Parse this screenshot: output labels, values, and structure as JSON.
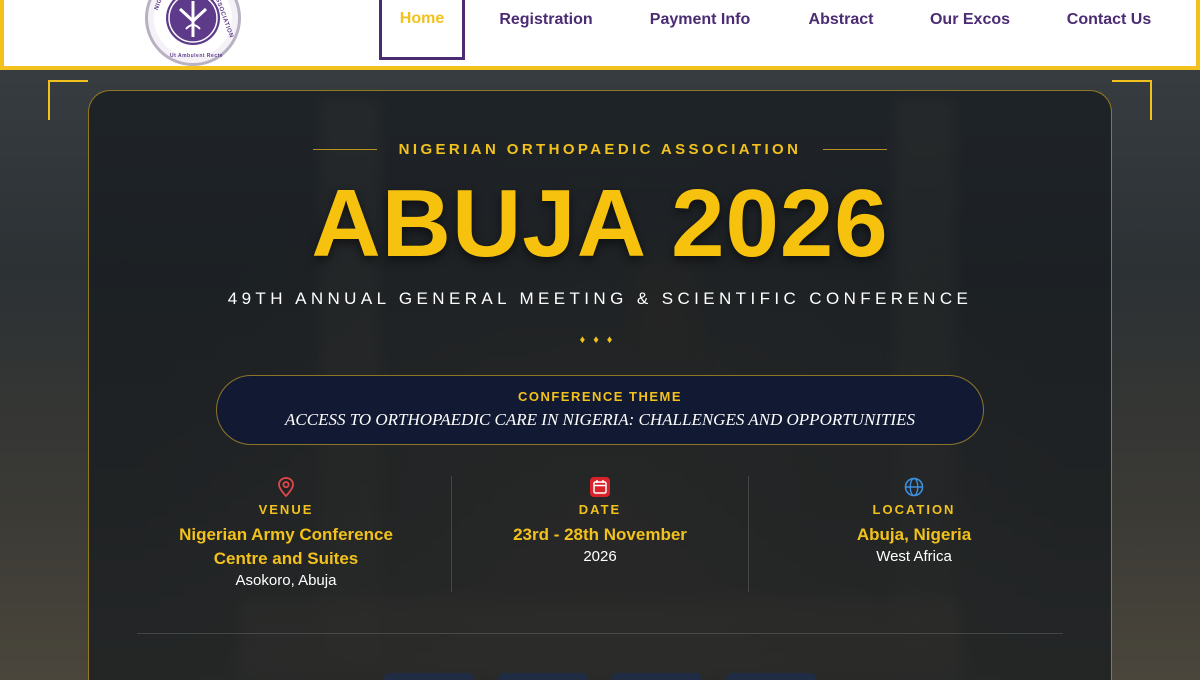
{
  "nav": {
    "items": [
      {
        "label": "Home",
        "active": true
      },
      {
        "label": "Registration",
        "active": false
      },
      {
        "label": "Payment Info",
        "active": false
      },
      {
        "label": "Abstract",
        "active": false
      },
      {
        "label": "Our Excos",
        "active": false
      },
      {
        "label": "Contact Us",
        "active": false
      }
    ]
  },
  "logo": {
    "ring_left": "NIGERIAN",
    "ring_right": "ASSOCIATION",
    "ring_bottom": "Ut Ambulent Recte"
  },
  "hero": {
    "eyebrow": "NIGERIAN ORTHOPAEDIC ASSOCIATION",
    "title": "ABUJA 2026",
    "subtitle": "49TH ANNUAL GENERAL MEETING & SCIENTIFIC CONFERENCE",
    "diamonds": "♦♦♦"
  },
  "theme": {
    "label": "CONFERENCE THEME",
    "text": "ACCESS TO ORTHOPAEDIC CARE IN NIGERIA: CHALLENGES AND OPPORTUNITIES"
  },
  "info": {
    "venue": {
      "label": "VENUE",
      "main": "Nigerian Army Conference Centre and Suites",
      "sub": "Asokoro, Abuja",
      "icon": "map-pin-icon",
      "color": "#e04848"
    },
    "date": {
      "label": "DATE",
      "main": "23rd - 28th November",
      "sub": "2026",
      "icon": "calendar-icon",
      "color": "#d8232a"
    },
    "location": {
      "label": "LOCATION",
      "main": "Abuja, Nigeria",
      "sub": "West Africa",
      "icon": "globe-icon",
      "color": "#3b8fe0"
    }
  },
  "colors": {
    "accent": "#f2c11c",
    "brand_purple": "#4b2c73",
    "theme_bg": "#121a33"
  }
}
